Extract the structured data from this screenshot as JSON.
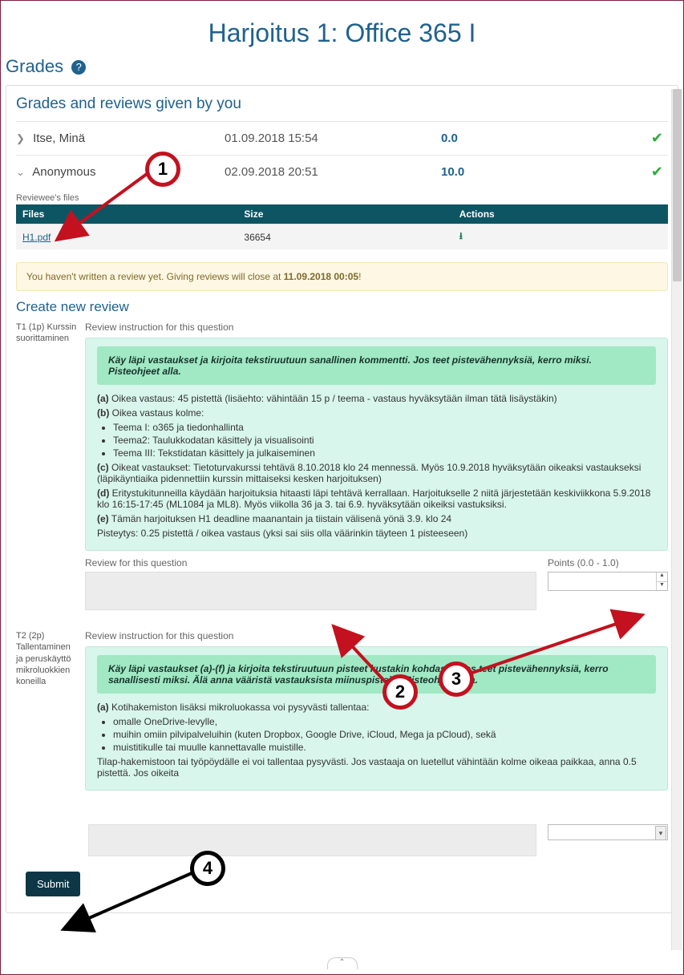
{
  "title": "Harjoitus  1: Office 365 I",
  "gradesHeading": "Grades",
  "givenHeading": "Grades and reviews given by you",
  "rows": [
    {
      "chev": "❯",
      "name": "Itse, Minä",
      "date": "01.09.2018 15:54",
      "score": "0.0"
    },
    {
      "chev": "⌄",
      "name": "Anonymous",
      "date": "02.09.2018 20:51",
      "score": "10.0"
    }
  ],
  "filesLabel": "Reviewee's files",
  "filesHeaders": {
    "files": "Files",
    "size": "Size",
    "actions": "Actions"
  },
  "file": {
    "name": "H1.pdf",
    "size": "36654"
  },
  "alert": {
    "pre": "You haven't written a review yet. Giving reviews will close at ",
    "bold": "11.09.2018 00:05",
    "post": "!"
  },
  "createHeading": "Create new review",
  "q1": {
    "side": "T1 (1p) Kurssin suorittaminen",
    "instrLabel": "Review instruction for this question",
    "green": "Käy läpi vastaukset ja kirjoita tekstiruutuun sanallinen kommentti. Jos teet pistevähennyksiä, kerro miksi. Pisteohjeet alla.",
    "a_b": "(a)",
    "a": "Oikea vastaus: 45 pistettä (lisäehto: vähintään 15 p / teema - vastaus hyväksytään ilman tätä lisäystäkin)",
    "b_b": "(b)",
    "b": "Oikea vastaus kolme:",
    "bl1": "Teema I: o365 ja tiedonhallinta",
    "bl2": "Teema2: Taulukkodatan käsittely ja visualisointi",
    "bl3": "Teema III: Tekstidatan käsittely ja julkaiseminen",
    "c_b": "(c)",
    "c": "Oikeat vastaukset: Tietoturvakurssi tehtävä 8.10.2018 klo 24 mennessä. Myös 10.9.2018 hyväksytään oikeaksi vastaukseksi (läpikäyntiaika pidennettiin kurssin mittaiseksi kesken harjoituksen)",
    "d_b": "(d)",
    "d": "Eritystukitunneilla käydään harjoituksia hitaasti läpi tehtävä kerrallaan. Harjoitukselle 2 niitä järjestetään keskiviikkona 5.9.2018 klo 16:15-17:45 (ML1084 ja ML8). Myös viikolla 36 ja 3. tai 6.9. hyväksytään oikeiksi vastuksiksi.",
    "e_b": "(e)",
    "e": "Tämän harjoituksen H1 deadline maanantain ja tiistain välisenä yönä 3.9. klo 24",
    "scoring": "Pisteytys: 0.25 pistettä / oikea vastaus (yksi sai siis olla väärinkin täyteen 1 pisteeseen)",
    "revLabel": "Review for this question",
    "ptsLabel": "Points (0.0 - 1.0)"
  },
  "q2": {
    "side": "T2 (2p) Tallentaminen ja peruskäyttö mikroluokkien koneilla",
    "instrLabel": "Review instruction for this question",
    "green": "Käy läpi vastaukset (a)-(f) ja kirjoita tekstiruutuun pisteet kustakin kohdasta. Jos teet pistevähennyksiä, kerro sanallisesti miksi. Älä anna vääristä vastauksista miinuspisteitä. Pisteohjeet alla.",
    "a_b": "(a)",
    "a": "Kotihakemiston lisäksi mikroluokassa voi pysyvästi tallentaa:",
    "al1": "omalle OneDrive-levylle,",
    "al2": "muihin omiin pilvipalveluihin (kuten Dropbox, Google Drive, iCloud, Mega ja pCloud), sekä",
    "al3": "muistitikulle tai muulle kannettavalle muistille.",
    "foot": "Tilap-hakemistoon tai työpöydälle ei voi tallentaa pysyvästi. Jos vastaaja on luetellut vähintään kolme oikeaa paikkaa, anna 0.5 pistettä. Jos oikeita"
  },
  "submit": "Submit",
  "annotations": {
    "n1": "1",
    "n2": "2",
    "n3": "3",
    "n4": "4"
  }
}
